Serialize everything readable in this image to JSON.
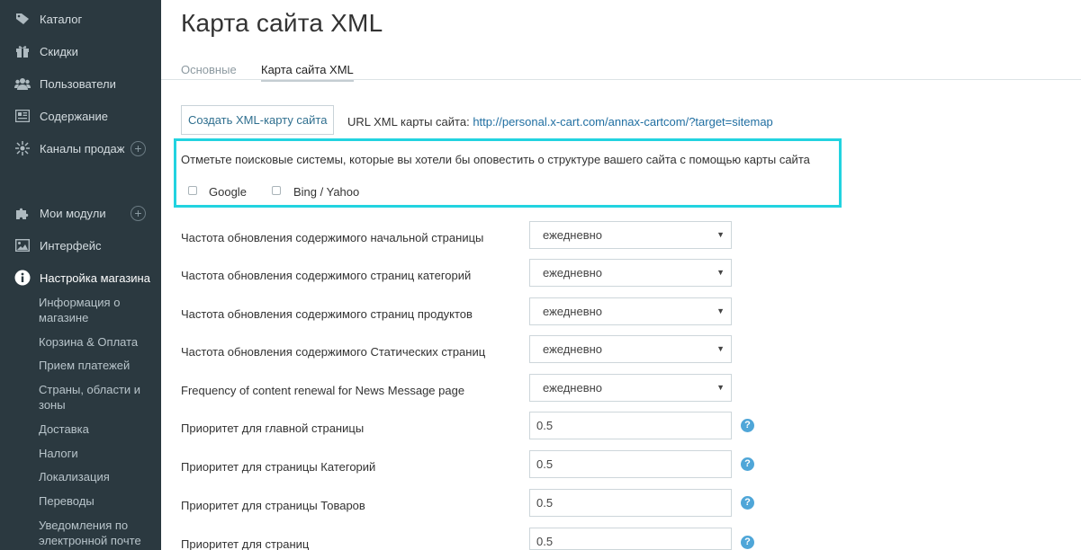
{
  "sidebar": {
    "items": [
      {
        "label": "Каталог",
        "icon": "tag-icon"
      },
      {
        "label": "Скидки",
        "icon": "gift-icon"
      },
      {
        "label": "Пользователи",
        "icon": "users-icon"
      },
      {
        "label": "Содержание",
        "icon": "content-icon"
      },
      {
        "label": "Каналы продаж",
        "icon": "sales-channels-icon",
        "plus": "+"
      },
      {
        "label": "Мои модули",
        "icon": "puzzle-icon",
        "plus": "+"
      },
      {
        "label": "Интерфейс",
        "icon": "image-icon"
      },
      {
        "label": "Настройка магазина",
        "icon": "info-icon"
      }
    ],
    "subitems": [
      "Информация о магазине",
      "Корзина & Оплата",
      "Прием платежей",
      "Страны, области и зоны",
      "Доставка",
      "Налоги",
      "Локализация",
      "Переводы",
      "Уведомления по электронной почте"
    ]
  },
  "main": {
    "title": "Карта сайта XML",
    "tabs": [
      {
        "label": "Основные",
        "active": false
      },
      {
        "label": "Карта сайта XML",
        "active": true
      }
    ],
    "create_button": "Создать XML-карту сайта",
    "url_label": "URL XML карты сайта:",
    "url_value": "http://personal.x-cart.com/annax-cartcom/?target=sitemap",
    "notify_text": "Отметьте поисковые системы, которые вы хотели бы оповестить о структуре вашего сайта с помощью карты сайта",
    "engines": [
      {
        "label": "Google",
        "checked": false
      },
      {
        "label": "Bing / Yahoo",
        "checked": false
      }
    ],
    "frequency_rows": [
      {
        "label": "Частота обновления содержимого начальной страницы",
        "value": "ежедневно"
      },
      {
        "label": "Частота обновления содержимого страниц категорий",
        "value": "ежедневно"
      },
      {
        "label": "Частота обновления содержимого страниц продуктов",
        "value": "ежедневно"
      },
      {
        "label": "Частота обновления содержимого Статических страниц",
        "value": "ежедневно"
      },
      {
        "label": "Frequency of content renewal for News Message page",
        "value": "ежедневно"
      }
    ],
    "priority_rows": [
      {
        "label": "Приоритет для главной страницы",
        "value": "0.5"
      },
      {
        "label": "Приоритет для страницы Категорий",
        "value": "0.5"
      },
      {
        "label": "Приоритет для страницы Товаров",
        "value": "0.5"
      },
      {
        "label": "Приоритет для страниц",
        "value": "0.5"
      }
    ],
    "help_glyph": "?",
    "select_arrow": "▼"
  },
  "colors": {
    "sidebar_bg": "#2b3940",
    "highlight": "#22d3e0",
    "link": "#1f6ea1",
    "help": "#4fa6d8"
  }
}
